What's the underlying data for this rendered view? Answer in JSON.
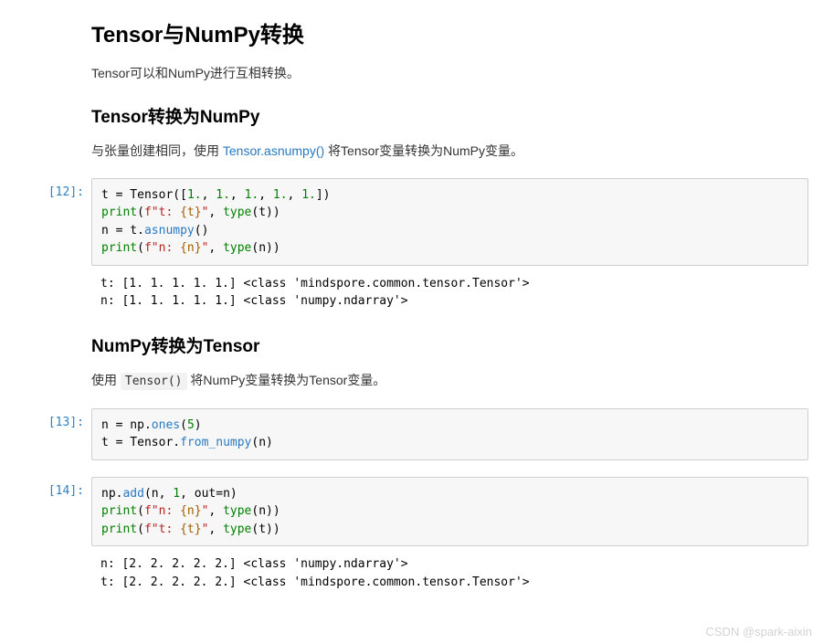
{
  "headings": {
    "h1": "Tensor与NumPy转换",
    "p1": "Tensor可以和NumPy进行互相转换。",
    "h2a": "Tensor转换为NumPy",
    "p2_before": "与张量创建相同，使用 ",
    "p2_link": "Tensor.asnumpy()",
    "p2_after": " 将Tensor变量转换为NumPy变量。",
    "h2b": "NumPy转换为Tensor",
    "p3_before": "使用 ",
    "p3_code": "Tensor()",
    "p3_after": " 将NumPy变量转换为Tensor变量。"
  },
  "cells": {
    "c12": {
      "prompt": "[12]:",
      "code": {
        "l1a": "t ",
        "l1b": "=",
        "l1c": " Tensor([",
        "l1d": "1.",
        "l1e": ", ",
        "l1f": "1.",
        "l1g": ", ",
        "l1h": "1.",
        "l1i": ", ",
        "l1j": "1.",
        "l1k": ", ",
        "l1l": "1.",
        "l1m": "])",
        "l2a": "print",
        "l2b": "(",
        "l2c": "f\"t: ",
        "l2d": "{t}",
        "l2e": "\"",
        "l2f": ", ",
        "l2g": "type",
        "l2h": "(t))",
        "l3a": "n ",
        "l3b": "=",
        "l3c": " t.",
        "l3d": "asnumpy",
        "l3e": "()",
        "l4a": "print",
        "l4b": "(",
        "l4c": "f\"n: ",
        "l4d": "{n}",
        "l4e": "\"",
        "l4f": ", ",
        "l4g": "type",
        "l4h": "(n))"
      },
      "output": "t: [1. 1. 1. 1. 1.] <class 'mindspore.common.tensor.Tensor'>\nn: [1. 1. 1. 1. 1.] <class 'numpy.ndarray'>"
    },
    "c13": {
      "prompt": "[13]:",
      "code": {
        "l1a": "n ",
        "l1b": "=",
        "l1c": " np.",
        "l1d": "ones",
        "l1e": "(",
        "l1f": "5",
        "l1g": ")",
        "l2a": "t ",
        "l2b": "=",
        "l2c": " Tensor.",
        "l2d": "from_numpy",
        "l2e": "(n)"
      }
    },
    "c14": {
      "prompt": "[14]:",
      "code": {
        "l1a": "np.",
        "l1b": "add",
        "l1c": "(n, ",
        "l1d": "1",
        "l1e": ", out",
        "l1f": "=",
        "l1g": "n)",
        "l2a": "print",
        "l2b": "(",
        "l2c": "f\"n: ",
        "l2d": "{n}",
        "l2e": "\"",
        "l2f": ", ",
        "l2g": "type",
        "l2h": "(n))",
        "l3a": "print",
        "l3b": "(",
        "l3c": "f\"t: ",
        "l3d": "{t}",
        "l3e": "\"",
        "l3f": ", ",
        "l3g": "type",
        "l3h": "(t))"
      },
      "output": "n: [2. 2. 2. 2. 2.] <class 'numpy.ndarray'>\nt: [2. 2. 2. 2. 2.] <class 'mindspore.common.tensor.Tensor'>"
    }
  },
  "watermark": "CSDN @spark-aixin"
}
